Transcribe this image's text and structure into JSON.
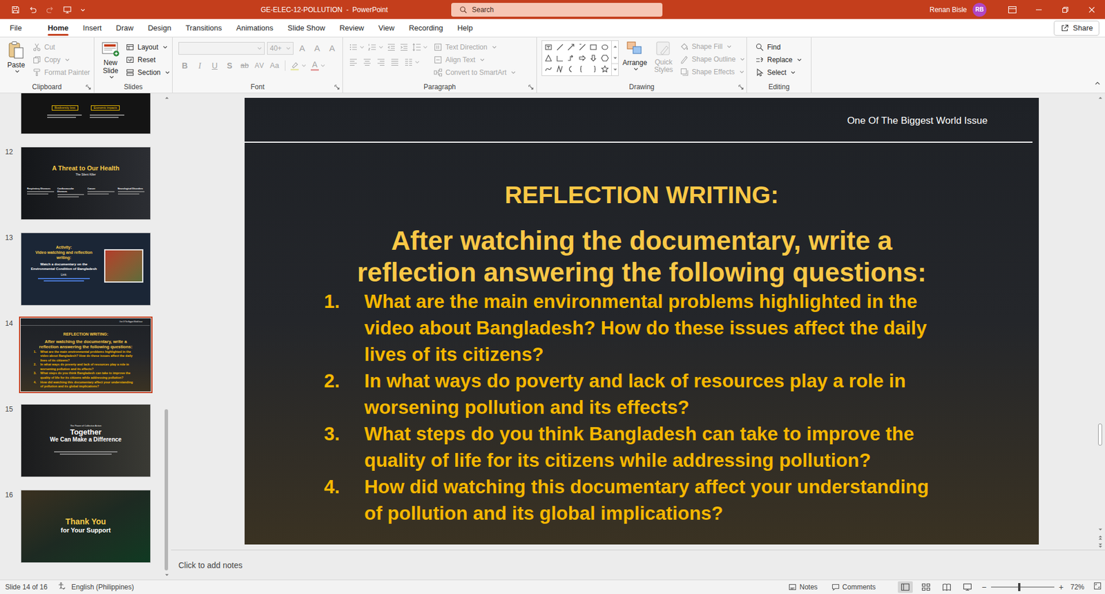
{
  "window": {
    "title": "GE-ELEC-12-POLLUTION  -  PowerPoint",
    "search_placeholder": "Search",
    "user": "Renan Bisle",
    "user_initials": "RB"
  },
  "menu_tabs": [
    {
      "label": "File",
      "selected": false
    },
    {
      "label": "Home",
      "selected": true
    },
    {
      "label": "Insert",
      "selected": false
    },
    {
      "label": "Draw",
      "selected": false
    },
    {
      "label": "Design",
      "selected": false
    },
    {
      "label": "Transitions",
      "selected": false
    },
    {
      "label": "Animations",
      "selected": false
    },
    {
      "label": "Slide Show",
      "selected": false
    },
    {
      "label": "Review",
      "selected": false
    },
    {
      "label": "View",
      "selected": false
    },
    {
      "label": "Recording",
      "selected": false
    },
    {
      "label": "Help",
      "selected": false
    }
  ],
  "share": "Share",
  "ribbon": {
    "clipboard": {
      "label": "Clipboard",
      "paste": "Paste",
      "items": [
        {
          "label": "Cut",
          "disabled": true,
          "dropdown": false
        },
        {
          "label": "Copy",
          "disabled": true,
          "dropdown": true
        },
        {
          "label": "Format Painter",
          "disabled": true,
          "dropdown": false
        }
      ]
    },
    "slides": {
      "label": "Slides",
      "new_slide": "New Slide",
      "items": [
        {
          "label": "Layout",
          "disabled": false,
          "dropdown": true
        },
        {
          "label": "Reset",
          "disabled": false,
          "dropdown": false
        },
        {
          "label": "Section",
          "disabled": false,
          "dropdown": true
        }
      ]
    },
    "font": {
      "label": "Font",
      "size": "40+",
      "disabled": true,
      "size_buttons": [
        "A",
        "A",
        "A"
      ],
      "format_buttons": [
        {
          "label": "B",
          "kind": "bold"
        },
        {
          "label": "I",
          "kind": "italic"
        },
        {
          "label": "U",
          "kind": "underline"
        },
        {
          "label": "S",
          "kind": "shadow"
        },
        {
          "label": "ab",
          "kind": "strike"
        },
        {
          "label": "AV",
          "kind": "spacing"
        },
        {
          "label": "Aa",
          "kind": "case"
        }
      ],
      "color_letter": "A"
    },
    "paragraph": {
      "label": "Paragraph",
      "items": [
        {
          "label": "Text Direction",
          "disabled": true,
          "dropdown": true
        },
        {
          "label": "Align Text",
          "disabled": true,
          "dropdown": true
        },
        {
          "label": "Convert to SmartArt",
          "disabled": true,
          "dropdown": true
        }
      ]
    },
    "drawing": {
      "label": "Drawing",
      "arrange": {
        "label": "Arrange",
        "disabled": false
      },
      "quick_styles": {
        "label": "Quick Styles",
        "disabled": true
      },
      "items": [
        {
          "label": "Shape Fill",
          "disabled": true,
          "dropdown": true
        },
        {
          "label": "Shape Outline",
          "disabled": true,
          "dropdown": true
        },
        {
          "label": "Shape Effects",
          "disabled": true,
          "dropdown": true
        }
      ]
    },
    "editing": {
      "label": "Editing",
      "items": [
        {
          "label": "Find",
          "disabled": false,
          "dropdown": false
        },
        {
          "label": "Replace",
          "disabled": false,
          "dropdown": true
        },
        {
          "label": "Select",
          "disabled": false,
          "dropdown": true
        }
      ]
    }
  },
  "thumbnails": [
    {
      "kind": "grid",
      "selected": false,
      "texts": [
        "Biodiversity loss",
        "Economic impacts"
      ]
    },
    {
      "number": "12",
      "kind": "health",
      "selected": false,
      "title": "A Threat to Our Health",
      "subtitle": "The Silent Killer",
      "texts": [
        "Respiratory Diseases",
        "Cardiovascular Diseases",
        "Cancer",
        "Neurological Disorders"
      ]
    },
    {
      "number": "13",
      "kind": "activity",
      "selected": false,
      "title": "Activity:",
      "subtitle": "Video watching and reflection writing:",
      "texts": [
        "Watch a documentary on the Environmental Condition of Bangladesh",
        "Link:"
      ]
    },
    {
      "number": "14",
      "kind": "reflection",
      "selected": true
    },
    {
      "number": "15",
      "kind": "together",
      "selected": false,
      "title": "Together",
      "subtitle": "We Can Make a Difference",
      "texts": [
        "The Power of Collective Action"
      ]
    },
    {
      "number": "16",
      "kind": "thanks",
      "selected": false,
      "title": "Thank You",
      "subtitle": "for Your Support"
    }
  ],
  "slide": {
    "header": "One Of The Biggest World Issue",
    "title": "REFLECTION WRITING:",
    "subtitle": "After watching the documentary, write a reflection answering the following questions:",
    "questions": [
      {
        "number": "1.",
        "text": "What are the main environmental problems highlighted in the video about Bangladesh? How do these issues affect the daily lives of its citizens?"
      },
      {
        "number": "2.",
        "text": "In what ways do poverty and lack of resources play a role in worsening pollution and its effects?"
      },
      {
        "number": "3.",
        "text": "What steps do you think Bangladesh can take to improve the quality of life for its citizens while addressing pollution?"
      },
      {
        "number": "4.",
        "text": "How did watching this documentary affect your understanding of pollution and its global implications?"
      }
    ]
  },
  "notes_placeholder": "Click to add notes",
  "scrollbars": {
    "thumbnails": {
      "level": 1
    },
    "editor": {
      "level": 0.8
    }
  },
  "status": {
    "slide_info": "Slide 14 of 16",
    "language": "English (Philippines)",
    "notes": "Notes",
    "comments": "Comments",
    "views": [
      {
        "kind": "normal",
        "selected": true
      },
      {
        "kind": "sorter",
        "selected": false
      },
      {
        "kind": "reading",
        "selected": false
      },
      {
        "kind": "slideshow",
        "selected": false
      }
    ],
    "zoom": {
      "minus": "−",
      "plus": "+",
      "level": 0.45,
      "reading": "72%"
    }
  }
}
